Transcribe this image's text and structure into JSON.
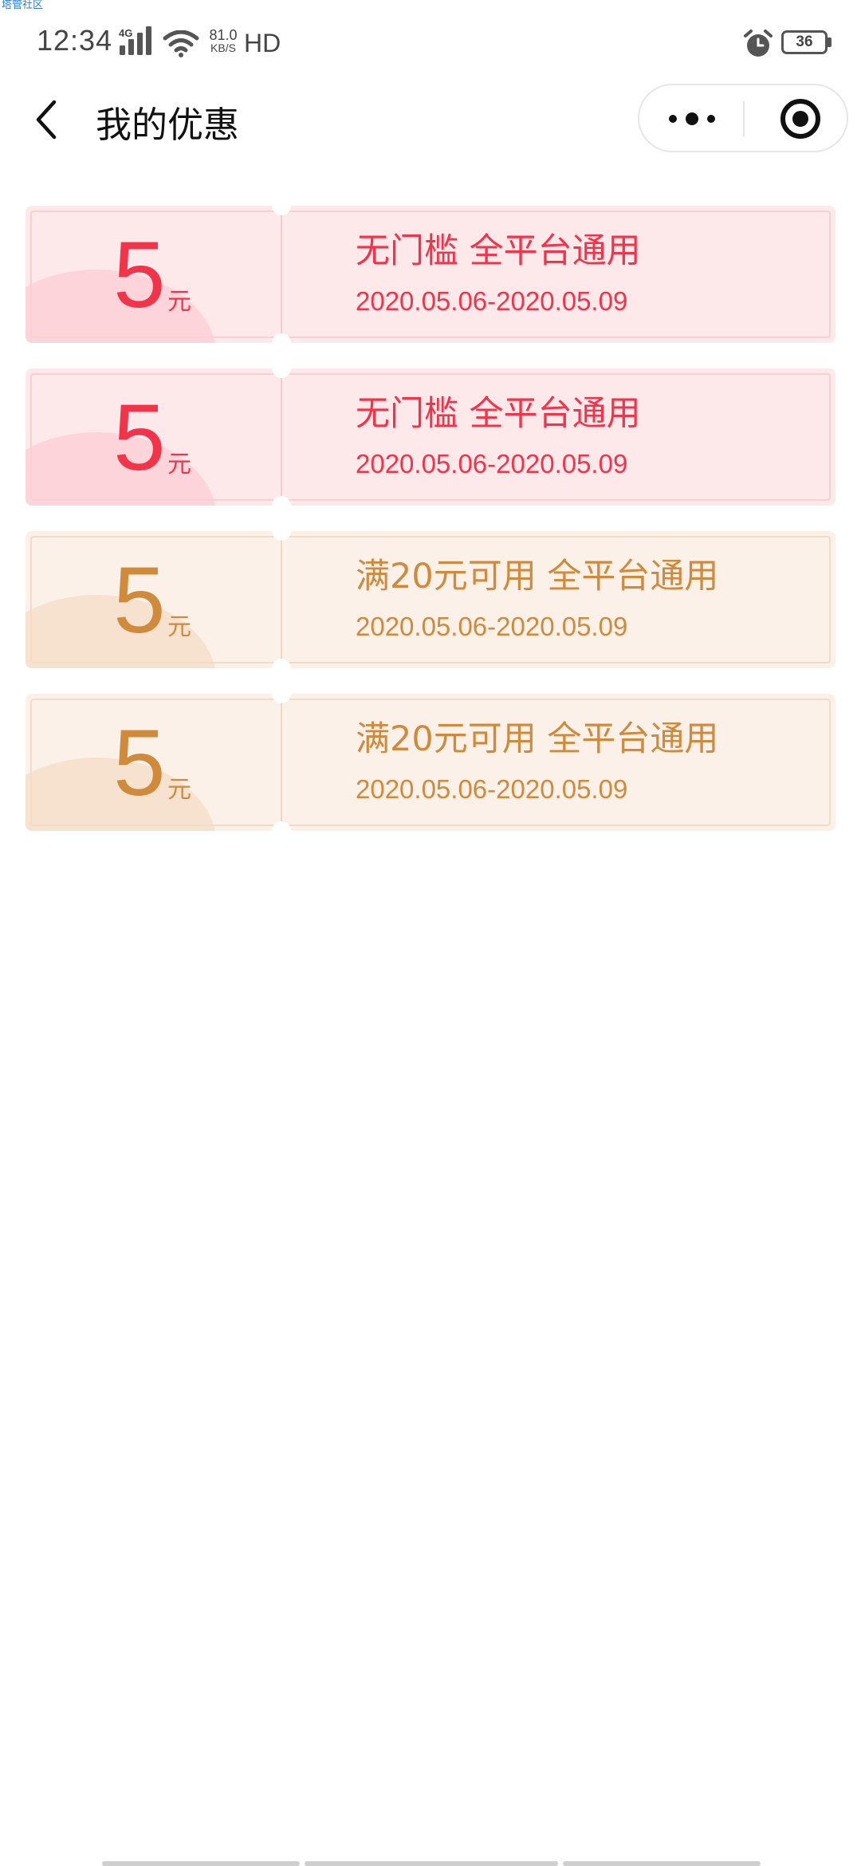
{
  "watermark": "塔管社区",
  "status_bar": {
    "time": "12:34",
    "network": "4G",
    "speed_value": "81.0",
    "speed_unit": "KB/S",
    "hd": "HD",
    "battery": "36",
    "icons": [
      "signal-icon",
      "wifi-icon",
      "alarm-icon",
      "battery-icon"
    ]
  },
  "nav": {
    "title": "我的优惠",
    "icons": [
      "back-arrow-icon",
      "more-dots-icon",
      "close-target-icon"
    ]
  },
  "colors": {
    "red_text": "#f2344a",
    "red_bg": "#fde8ea",
    "gold_text": "#d08a3c",
    "gold_bg": "#fbf1e9"
  },
  "coupons": [
    {
      "style": "red",
      "amount": "5",
      "unit": "元",
      "condition": "无门槛 全平台通用",
      "validity": "2020.05.06-2020.05.09"
    },
    {
      "style": "red",
      "amount": "5",
      "unit": "元",
      "condition": "无门槛 全平台通用",
      "validity": "2020.05.06-2020.05.09"
    },
    {
      "style": "gold",
      "amount": "5",
      "unit": "元",
      "condition": "满20元可用 全平台通用",
      "validity": "2020.05.06-2020.05.09"
    },
    {
      "style": "gold",
      "amount": "5",
      "unit": "元",
      "condition": "满20元可用 全平台通用",
      "validity": "2020.05.06-2020.05.09"
    }
  ]
}
